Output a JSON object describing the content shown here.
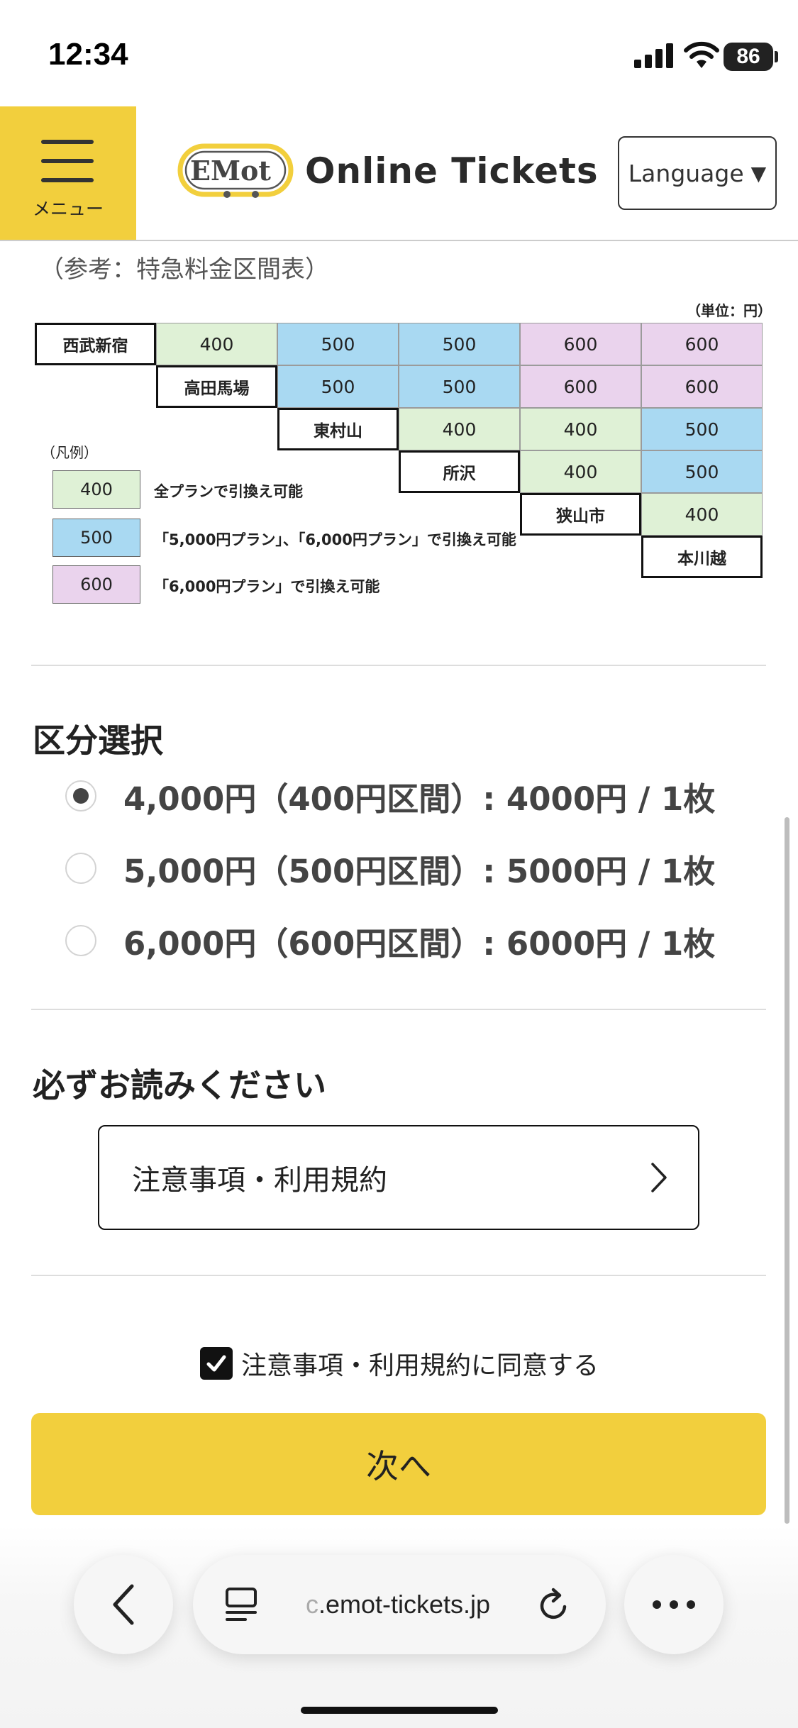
{
  "status_bar": {
    "time": "12:34",
    "battery": "86",
    "icons": [
      "cellular-signal-icon",
      "wifi-icon",
      "battery-icon"
    ]
  },
  "header": {
    "menu_label": "メニュー",
    "logo_badge": "EMot",
    "logo_text": "Online Tickets",
    "language_label": "Language",
    "language_arrow": "▼"
  },
  "fare_table": {
    "caption": "（参考：特急料金区間表）",
    "unit": "（単位：円）",
    "stations": [
      "西武新宿",
      "高田馬場",
      "東村山",
      "所沢",
      "狭山市",
      "本川越"
    ],
    "rows": [
      [
        "400",
        "500",
        "500",
        "600",
        "600"
      ],
      [
        "500",
        "500",
        "600",
        "600"
      ],
      [
        "400",
        "400",
        "500"
      ],
      [
        "400",
        "500"
      ],
      [
        "400"
      ]
    ],
    "colors": {
      "400": "#dff1d6",
      "500": "#a9d9f2",
      "600": "#ead3ed"
    },
    "legend_title": "（凡例）",
    "legend": [
      {
        "value": "400",
        "text": "全プランで引換え可能"
      },
      {
        "value": "500",
        "text": "「5,000円プラン」、「6,000円プラン」で引換え可能"
      },
      {
        "value": "600",
        "text": "「6,000円プラン」で引換え可能"
      }
    ]
  },
  "category": {
    "title": "区分選択",
    "options": [
      {
        "label": "4,000円（400円区間）: 4000円 / 1枚",
        "checked": true
      },
      {
        "label": "5,000円（500円区間）: 5000円 / 1枚",
        "checked": false
      },
      {
        "label": "6,000円（600円区間）: 6000円 / 1枚",
        "checked": false
      }
    ]
  },
  "notice": {
    "title": "必ずお読みください",
    "terms_button": "注意事項・利用規約"
  },
  "agree": {
    "label": "注意事項・利用規約に同意する",
    "checked": true
  },
  "next_button": "次へ",
  "browser": {
    "url_faded": "c",
    "url": ".emot-tickets.jp"
  },
  "accent_color": "#f2cf3d"
}
